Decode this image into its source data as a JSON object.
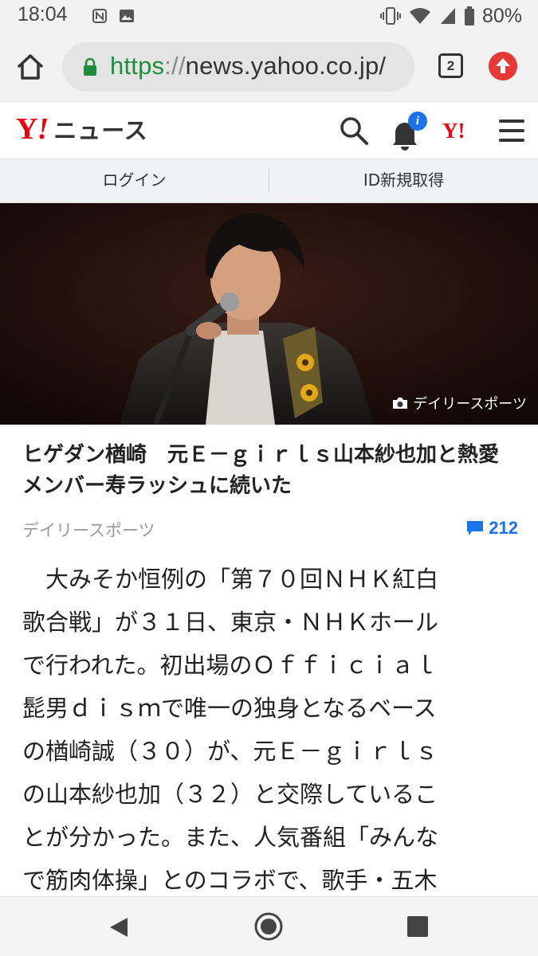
{
  "status_bar": {
    "time": "18:04",
    "battery": "80%"
  },
  "browser": {
    "url_scheme": "https",
    "url_separator": "://",
    "url_host": "news.yahoo.co.jp/",
    "tab_count": "2"
  },
  "yahoo_header": {
    "logo_y": "Y",
    "logo_mark": "!",
    "logo_text": "ニュース",
    "notification_badge": "i",
    "small_logo": "Y!"
  },
  "login_bar": {
    "login_label": "ログイン",
    "register_label": "ID新規取得"
  },
  "hero": {
    "photo_credit": "デイリースポーツ"
  },
  "article": {
    "headline": "ヒゲダン楢崎　元Ｅ－ｇｉｒｌｓ山本紗也加と熱愛　メンバー寿ラッシュに続いた",
    "source": "デイリースポーツ",
    "comment_count": "212",
    "body_lines": [
      "　大みそか恒例の「第７０回ＮＨＫ紅白",
      "歌合戦」が３１日、東京・ＮＨＫホール",
      "で行われた。初出場のＯｆｆｉｃｉａｌ",
      "髭男ｄｉｓｍで唯一の独身となるベース",
      "の楢崎誠（３０）が、元Ｅ－ｇｉｒｌｓ",
      "の山本紗也加（３２）と交際しているこ",
      "とが分かった。また、人気番組「みんな",
      "で筋肉体操」とのコラボで、歌手・五木"
    ]
  },
  "colors": {
    "yahoo_red": "#e60012",
    "link_blue": "#1a73e8",
    "secure_green": "#1e8e3e"
  }
}
